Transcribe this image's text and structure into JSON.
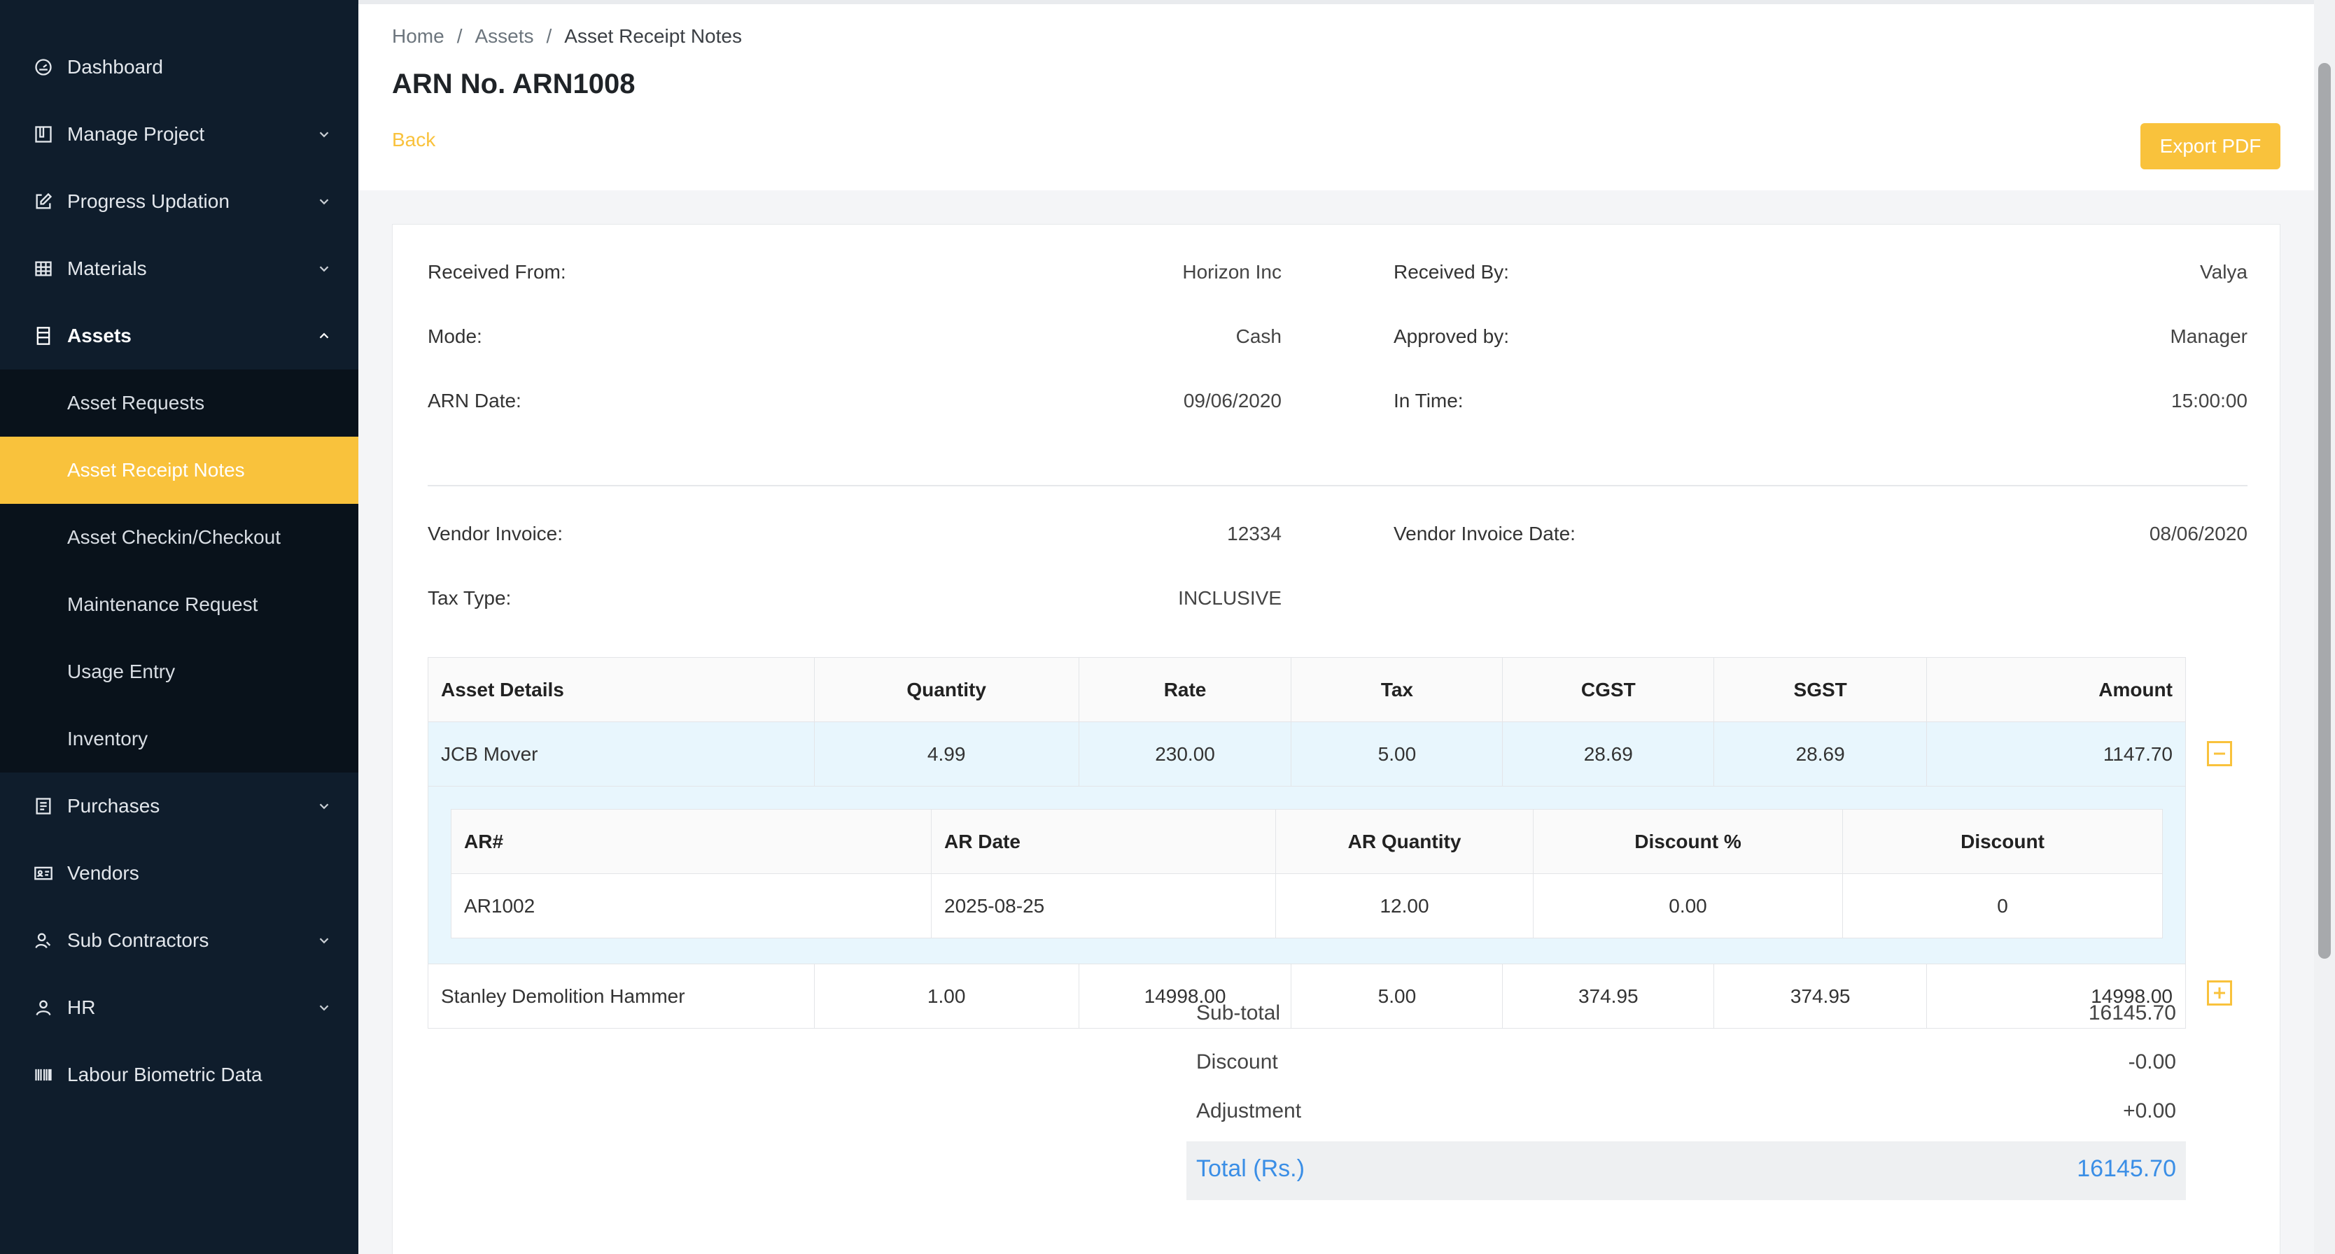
{
  "sidebar": {
    "items": [
      {
        "label": "Dashboard",
        "icon": "dashboard-icon"
      },
      {
        "label": "Manage Project",
        "icon": "project-icon"
      },
      {
        "label": "Progress Updation",
        "icon": "edit-icon"
      },
      {
        "label": "Materials",
        "icon": "grid-icon"
      },
      {
        "label": "Assets",
        "icon": "assets-icon"
      },
      {
        "label": "Purchases",
        "icon": "purchases-icon"
      },
      {
        "label": "Vendors",
        "icon": "vendor-card-icon"
      },
      {
        "label": "Sub Contractors",
        "icon": "contractor-icon"
      },
      {
        "label": "HR",
        "icon": "user-icon"
      },
      {
        "label": "Labour Biometric Data",
        "icon": "barcode-icon"
      }
    ],
    "assets_submenu": [
      {
        "label": "Asset Requests"
      },
      {
        "label": "Asset Receipt Notes"
      },
      {
        "label": "Asset Checkin/Checkout"
      },
      {
        "label": "Maintenance Request"
      },
      {
        "label": "Usage Entry"
      },
      {
        "label": "Inventory"
      }
    ],
    "active_color": "#f9c23c"
  },
  "breadcrumb": {
    "home": "Home",
    "sep": "/",
    "section": "Assets",
    "current": "Asset Receipt Notes"
  },
  "page": {
    "title": "ARN No. ARN1008",
    "back_label": "Back",
    "export_label": "Export PDF"
  },
  "details": {
    "received_from_label": "Received From:",
    "received_from": "Horizon Inc",
    "received_by_label": "Received By:",
    "received_by": "Valya",
    "mode_label": "Mode:",
    "mode": "Cash",
    "approved_by_label": "Approved by:",
    "approved_by": "Manager",
    "arn_date_label": "ARN Date:",
    "arn_date": "09/06/2020",
    "in_time_label": "In Time:",
    "in_time": "15:00:00",
    "vendor_invoice_label": "Vendor Invoice:",
    "vendor_invoice": "12334",
    "vendor_invoice_date_label": "Vendor Invoice Date:",
    "vendor_invoice_date": "08/06/2020",
    "tax_type_label": "Tax Type:",
    "tax_type": "INCLUSIVE"
  },
  "table": {
    "headers": [
      "Asset Details",
      "Quantity",
      "Rate",
      "Tax",
      "CGST",
      "SGST",
      "Amount"
    ],
    "rows": [
      {
        "name": "JCB Mover",
        "qty": "4.99",
        "rate": "230.00",
        "tax": "5.00",
        "cgst": "28.69",
        "sgst": "28.69",
        "amount": "1147.70"
      },
      {
        "name": "Stanley Demolition Hammer",
        "qty": "1.00",
        "rate": "14998.00",
        "tax": "5.00",
        "cgst": "374.95",
        "sgst": "374.95",
        "amount": "14998.00"
      }
    ],
    "nested_headers": [
      "AR#",
      "AR Date",
      "AR Quantity",
      "Discount %",
      "Discount"
    ],
    "nested_rows": [
      {
        "ar": "AR1002",
        "date": "2025-08-25",
        "qty": "12.00",
        "disc_pct": "0.00",
        "disc": "0"
      }
    ]
  },
  "totals": {
    "subtotal_label": "Sub-total",
    "subtotal": "16145.70",
    "discount_label": "Discount",
    "discount": "-0.00",
    "adjustment_label": "Adjustment",
    "adjustment": "+0.00",
    "total_label": "Total (Rs.)",
    "total": "16145.70",
    "total_color": "#3a8ee6"
  }
}
